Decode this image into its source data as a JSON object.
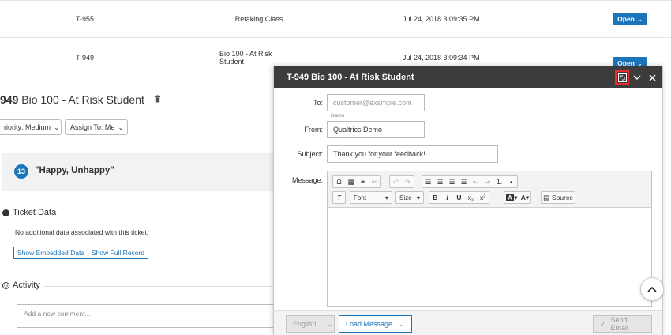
{
  "table": {
    "rows": [
      {
        "id": "T-955",
        "name": "Retaking Class",
        "date": "Jul 24, 2018 3:09:35 PM",
        "action": "Open"
      },
      {
        "id": "T-949",
        "name": "Bio 100 - At Risk Student",
        "date": "Jul 24, 2018 3:09:34 PM",
        "action": "Open"
      }
    ]
  },
  "ticket": {
    "title_id": "949",
    "title_name": "Bio 100 - At Risk Student",
    "priority": "riority: Medium",
    "assign": "Assign To: Me",
    "response_number": "13",
    "response_text": "\"Happy, Unhappy\"",
    "data_heading": "Ticket Data",
    "no_data": "No additional data associated with this ticket.",
    "embedded_btn": "Show Embedded Data",
    "full_record_btn": "Show Full Record",
    "activity_heading": "Activity",
    "comment_placeholder": "Add a new comment..."
  },
  "email": {
    "title": "T-949 Bio 100 - At Risk Student",
    "to_label": "To:",
    "to_placeholder": "customer@example.com",
    "name_hint": "Name",
    "from_label": "From:",
    "from_value": "Qualtrics Demo",
    "subject_label": "Subject:",
    "subject_value": "Thank you for your feedback!",
    "message_label": "Message:",
    "font_label": "Font",
    "size_label": "Size",
    "source_label": "Source",
    "lang_label": "English...",
    "load_label": "Load Message",
    "send_label": "Send Email"
  },
  "colors": {
    "accent": "#1b75bb",
    "header_bg": "#3c3c3c",
    "highlight": "#e53030"
  }
}
